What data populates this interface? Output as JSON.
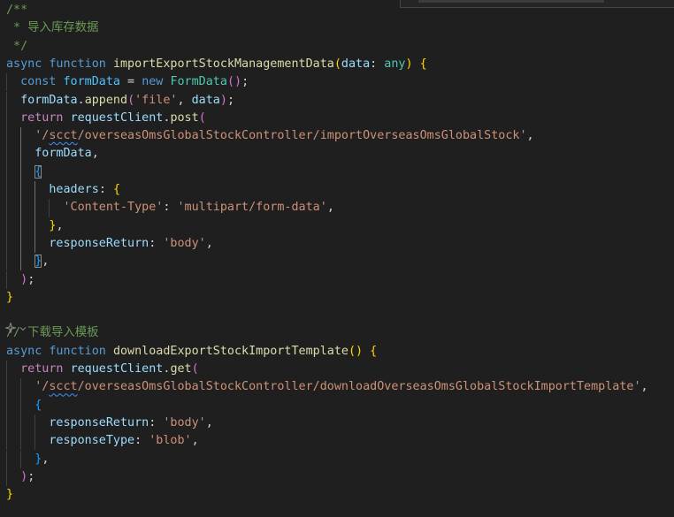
{
  "window": {
    "title": ""
  },
  "theme": {
    "background": "#1f1f1f",
    "comment": "#6a9955",
    "keyword": "#569cd6",
    "control": "#c586c0",
    "function": "#dcdcaa",
    "variable": "#9cdcfe",
    "type": "#4ec9b0",
    "string": "#ce9178",
    "bracket_level_1": "#ffd700",
    "bracket_level_2": "#da70d6",
    "bracket_level_3": "#179fff"
  },
  "gutter": {
    "sparkle_icon": "sparkle-icon",
    "chevron_icon": "chevron-down-icon"
  },
  "code_lines": [
    [
      [
        "/**",
        "comment"
      ]
    ],
    [
      [
        " * 导入库存数据",
        "comment"
      ]
    ],
    [
      [
        " */",
        "comment"
      ]
    ],
    [
      [
        "async",
        "kw"
      ],
      [
        " ",
        "punc"
      ],
      [
        "function",
        "kw"
      ],
      [
        " ",
        "punc"
      ],
      [
        "importExportStockManagementData",
        "fn"
      ],
      [
        "(",
        "b1"
      ],
      [
        "data",
        "var"
      ],
      [
        ": ",
        "punc"
      ],
      [
        "any",
        "type"
      ],
      [
        ")",
        "b1"
      ],
      [
        " ",
        "punc"
      ],
      [
        "{",
        "b1"
      ]
    ],
    [
      [
        "  ",
        "punc"
      ],
      [
        "const",
        "kw"
      ],
      [
        " ",
        "punc"
      ],
      [
        "formData",
        "const"
      ],
      [
        " = ",
        "punc"
      ],
      [
        "new",
        "kw"
      ],
      [
        " ",
        "punc"
      ],
      [
        "FormData",
        "type"
      ],
      [
        "()",
        "b2"
      ],
      [
        ";",
        "punc"
      ]
    ],
    [
      [
        "  ",
        "punc"
      ],
      [
        "formData",
        "var"
      ],
      [
        ".",
        "punc"
      ],
      [
        "append",
        "fn"
      ],
      [
        "(",
        "b2"
      ],
      [
        "'file'",
        "str"
      ],
      [
        ", ",
        "punc"
      ],
      [
        "data",
        "var"
      ],
      [
        ")",
        "b2"
      ],
      [
        ";",
        "punc"
      ]
    ],
    [
      [
        "  ",
        "punc"
      ],
      [
        "return",
        "ctrl"
      ],
      [
        " ",
        "punc"
      ],
      [
        "requestClient",
        "var"
      ],
      [
        ".",
        "punc"
      ],
      [
        "post",
        "fn"
      ],
      [
        "(",
        "b2"
      ]
    ],
    [
      [
        "    ",
        "punc"
      ],
      [
        "'/",
        "str"
      ],
      [
        "scct",
        "str squig"
      ],
      [
        "/overseasOmsGlobalStockController/importOverseasOmsGlobalStock'",
        "str"
      ],
      [
        ",",
        "punc"
      ]
    ],
    [
      [
        "    ",
        "punc"
      ],
      [
        "formData",
        "var"
      ],
      [
        ",",
        "punc"
      ]
    ],
    [
      [
        "    ",
        "punc"
      ],
      [
        "{",
        "b3 bracket-box"
      ]
    ],
    [
      [
        "      ",
        "punc"
      ],
      [
        "headers",
        "var"
      ],
      [
        ": ",
        "punc"
      ],
      [
        "{",
        "b1"
      ]
    ],
    [
      [
        "        ",
        "punc"
      ],
      [
        "'Content-Type'",
        "str"
      ],
      [
        ": ",
        "punc"
      ],
      [
        "'multipart/form-data'",
        "str"
      ],
      [
        ",",
        "punc"
      ]
    ],
    [
      [
        "      ",
        "punc"
      ],
      [
        "}",
        "b1"
      ],
      [
        ",",
        "punc"
      ]
    ],
    [
      [
        "      ",
        "punc"
      ],
      [
        "responseReturn",
        "var"
      ],
      [
        ": ",
        "punc"
      ],
      [
        "'body'",
        "str"
      ],
      [
        ",",
        "punc"
      ]
    ],
    [
      [
        "    ",
        "punc"
      ],
      [
        "}",
        "b3 bracket-box"
      ],
      [
        ",",
        "punc"
      ]
    ],
    [
      [
        "  ",
        "punc"
      ],
      [
        ")",
        "b2"
      ],
      [
        ";",
        "punc"
      ]
    ],
    [
      [
        "}",
        "b1"
      ]
    ],
    [],
    [
      [
        "// 下载导入模板",
        "comment"
      ]
    ],
    [
      [
        "async",
        "kw"
      ],
      [
        " ",
        "punc"
      ],
      [
        "function",
        "kw"
      ],
      [
        " ",
        "punc"
      ],
      [
        "downloadExportStockImportTemplate",
        "fn"
      ],
      [
        "()",
        "b1"
      ],
      [
        " ",
        "punc"
      ],
      [
        "{",
        "b1"
      ]
    ],
    [
      [
        "  ",
        "punc"
      ],
      [
        "return",
        "ctrl"
      ],
      [
        " ",
        "punc"
      ],
      [
        "requestClient",
        "var"
      ],
      [
        ".",
        "punc"
      ],
      [
        "get",
        "fn"
      ],
      [
        "(",
        "b2"
      ]
    ],
    [
      [
        "    ",
        "punc"
      ],
      [
        "'/",
        "str"
      ],
      [
        "scct",
        "str squig"
      ],
      [
        "/overseasOmsGlobalStockController/downloadOverseasOmsGlobalStockImportTemplate'",
        "str"
      ],
      [
        ",",
        "punc"
      ]
    ],
    [
      [
        "    ",
        "punc"
      ],
      [
        "{",
        "b3"
      ]
    ],
    [
      [
        "      ",
        "punc"
      ],
      [
        "responseReturn",
        "var"
      ],
      [
        ": ",
        "punc"
      ],
      [
        "'body'",
        "str"
      ],
      [
        ",",
        "punc"
      ]
    ],
    [
      [
        "      ",
        "punc"
      ],
      [
        "responseType",
        "var"
      ],
      [
        ": ",
        "punc"
      ],
      [
        "'blob'",
        "str"
      ],
      [
        ",",
        "punc"
      ]
    ],
    [
      [
        "    ",
        "punc"
      ],
      [
        "}",
        "b3"
      ],
      [
        ",",
        "punc"
      ]
    ],
    [
      [
        "  ",
        "punc"
      ],
      [
        ")",
        "b2"
      ],
      [
        ";",
        "punc"
      ]
    ],
    [
      [
        "}",
        "b1"
      ]
    ]
  ]
}
